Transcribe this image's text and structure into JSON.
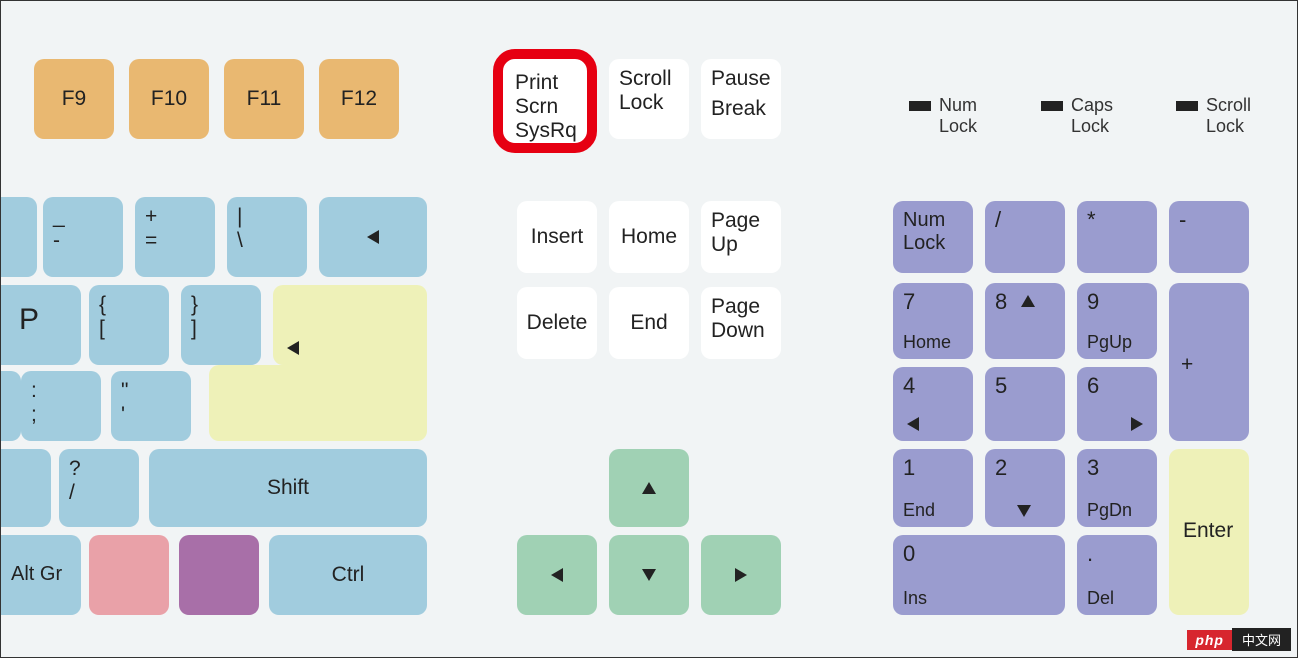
{
  "fkeys": {
    "f9": "F9",
    "f10": "F10",
    "f11": "F11",
    "f12": "F12"
  },
  "sys": {
    "print1": "Print",
    "print2": "Scrn",
    "print3": "SysRq",
    "scroll1": "Scroll",
    "scroll2": "Lock",
    "pause1": "Pause",
    "pause2": "Break"
  },
  "nav": {
    "insert": "Insert",
    "home": "Home",
    "pageup1": "Page",
    "pageup2": "Up",
    "delete": "Delete",
    "end": "End",
    "pagedown1": "Page",
    "pagedown2": "Down"
  },
  "mainrow1": {
    "minus1": "_",
    "minus2": "-",
    "plus1": "+",
    "plus2": "=",
    "pipe1": "|",
    "pipe2": "\\"
  },
  "mainrow2": {
    "p": "P",
    "brace1a": "{",
    "brace1b": "[",
    "brace2a": "}",
    "brace2b": "]"
  },
  "mainrow3": {
    "colon1": ":",
    "colon2": ";",
    "quote1": "\"",
    "quote2": "'"
  },
  "mainrow4": {
    "q1": "?",
    "q2": "/",
    "shift": "Shift"
  },
  "bottom": {
    "altgr": "Alt Gr",
    "ctrl": "Ctrl"
  },
  "indicators": {
    "num1": "Num",
    "num2": "Lock",
    "caps1": "Caps",
    "caps2": "Lock",
    "scroll1": "Scroll",
    "scroll2": "Lock"
  },
  "numpad": {
    "numlock1": "Num",
    "numlock2": "Lock",
    "slash": "/",
    "star": "*",
    "minus": "-",
    "plus": "+",
    "enter": "Enter",
    "k7": "7",
    "k7s": "Home",
    "k8": "8",
    "k9": "9",
    "k9s": "PgUp",
    "k4": "4",
    "k5": "5",
    "k6": "6",
    "k1": "1",
    "k1s": "End",
    "k2": "2",
    "k3": "3",
    "k3s": "PgDn",
    "k0": "0",
    "k0s": "Ins",
    "kdot": ".",
    "kdots": "Del"
  },
  "watermark": {
    "php": "php",
    "cn": "中文网"
  }
}
